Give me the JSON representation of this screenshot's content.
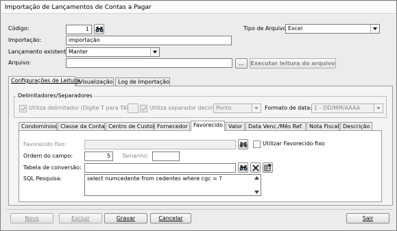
{
  "window": {
    "title": "Importação de Lançamentos de Contas a Pagar"
  },
  "form": {
    "codigo_label": "Código:",
    "codigo_value": "1",
    "tipo_arquivo_label": "Tipo de Arquivo:",
    "tipo_arquivo_value": "Excel",
    "importacao_label": "Importação:",
    "importacao_value": "importação",
    "lancamento_label": "Lançamento existente:",
    "lancamento_value": "Manter",
    "arquivo_label": "Arquivo:",
    "arquivo_value": "",
    "browse_label": "...",
    "executar_label": "Executar leitura do arquivo"
  },
  "main_tabs": [
    {
      "label": "Configurações de Leitura"
    },
    {
      "label": "Visualização"
    },
    {
      "label": "Log de Importação"
    }
  ],
  "delimitadores": {
    "group_label": "Delimitadores/Separadores",
    "utiliza_delimitador_label": "Utiliza delimitador (Digite T para TAB)",
    "delimitador_value": ".",
    "utiliza_separador_label": "Utiliza separador decimal",
    "separador_value": "Ponto",
    "formato_data_label": "Formato de data:",
    "formato_data_value": "1 - DD/MM/AAAA"
  },
  "sub_tabs": [
    {
      "label": "Condomínios"
    },
    {
      "label": "Classe da Conta"
    },
    {
      "label": "Centro de Custos"
    },
    {
      "label": "Fornecedor"
    },
    {
      "label": "Favorecido"
    },
    {
      "label": "Valor"
    },
    {
      "label": "Data Venc./Mês Ref."
    },
    {
      "label": "Nota Fiscal"
    },
    {
      "label": "Descrição"
    }
  ],
  "favorecido": {
    "fixo_label": "Favorecido fixo:",
    "fixo_value": "",
    "utilizar_fixo_label": "Utilizar Favorecido fixo",
    "ordem_label": "Ordem do campo:",
    "ordem_value": "5",
    "tamanho_label": "Tamanho:",
    "tamanho_value": "",
    "tabela_label": "Tabela de conversão:",
    "tabela_value": "",
    "sql_label": "SQL Pesquisa:",
    "sql_value": "select numcedente from cedentes where cgc = ?"
  },
  "footer": {
    "novo": "Novo",
    "excluir": "Excluir",
    "gravar": "Gravar",
    "cancelar": "Cancelar",
    "sair": "Sair"
  }
}
